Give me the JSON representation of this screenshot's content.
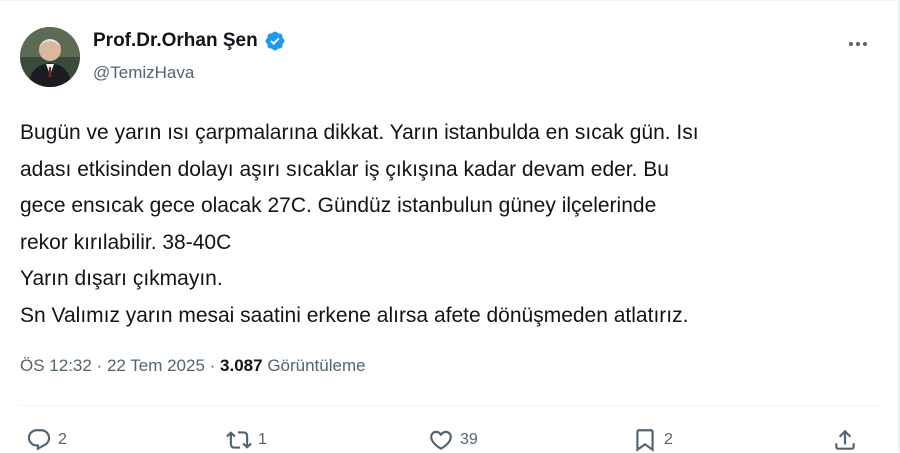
{
  "author": {
    "display_name": "Prof.Dr.Orhan Şen",
    "handle": "@TemizHava",
    "verified_icon": "verified-badge-icon",
    "accent_color": "#1d9bf0"
  },
  "tweet": {
    "lines": [
      "Bugün ve yarın ısı çarpmalarına dikkat. Yarın istanbulda en sıcak gün. Isı",
      "adası etkisinden dolayı aşırı sıcaklar iş çıkışına kadar devam eder. Bu",
      "gece ensıcak gece olacak 27C. Gündüz istanbulun güney ilçelerinde",
      "rekor kırılabilir. 38-40C",
      "Yarın dışarı çıkmayın.",
      "Sn Valımız yarın mesai saatini erkene alırsa afete dönüşmeden atlatırız."
    ]
  },
  "meta": {
    "time": "ÖS 12:32",
    "separator": " · ",
    "date": "22 Tem 2025",
    "views_count": "3.087",
    "views_label": "Görüntüleme"
  },
  "actions": {
    "replies": {
      "icon": "reply-icon",
      "count": "2"
    },
    "reposts": {
      "icon": "repost-icon",
      "count": "1"
    },
    "likes": {
      "icon": "like-icon",
      "count": "39"
    },
    "bookmarks": {
      "icon": "bookmark-icon",
      "count": "2"
    },
    "share": {
      "icon": "share-icon"
    }
  },
  "more_menu": {
    "icon": "more-options-icon"
  }
}
